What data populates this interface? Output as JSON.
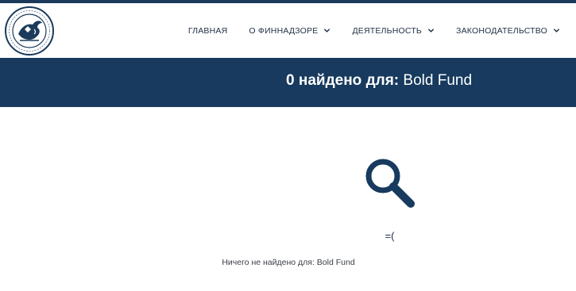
{
  "nav": {
    "items": [
      {
        "label": "ГЛАВНАЯ",
        "has_dropdown": false
      },
      {
        "label": "О ФИННАДЗОРЕ",
        "has_dropdown": true
      },
      {
        "label": "ДЕЯТЕЛЬНОСТЬ",
        "has_dropdown": true
      },
      {
        "label": "ЗАКОНОДАТЕЛЬСТВО",
        "has_dropdown": true
      }
    ]
  },
  "banner": {
    "count": "0",
    "found_for": "найдено для:",
    "query": "Bold Fund"
  },
  "results": {
    "emoticon": "=(",
    "message": "Ничего не найдено для: Bold Fund",
    "icon": "search-icon"
  },
  "colors": {
    "primary": "#173a5e",
    "nav_text": "#1f2f44",
    "background": "#ffffff"
  }
}
